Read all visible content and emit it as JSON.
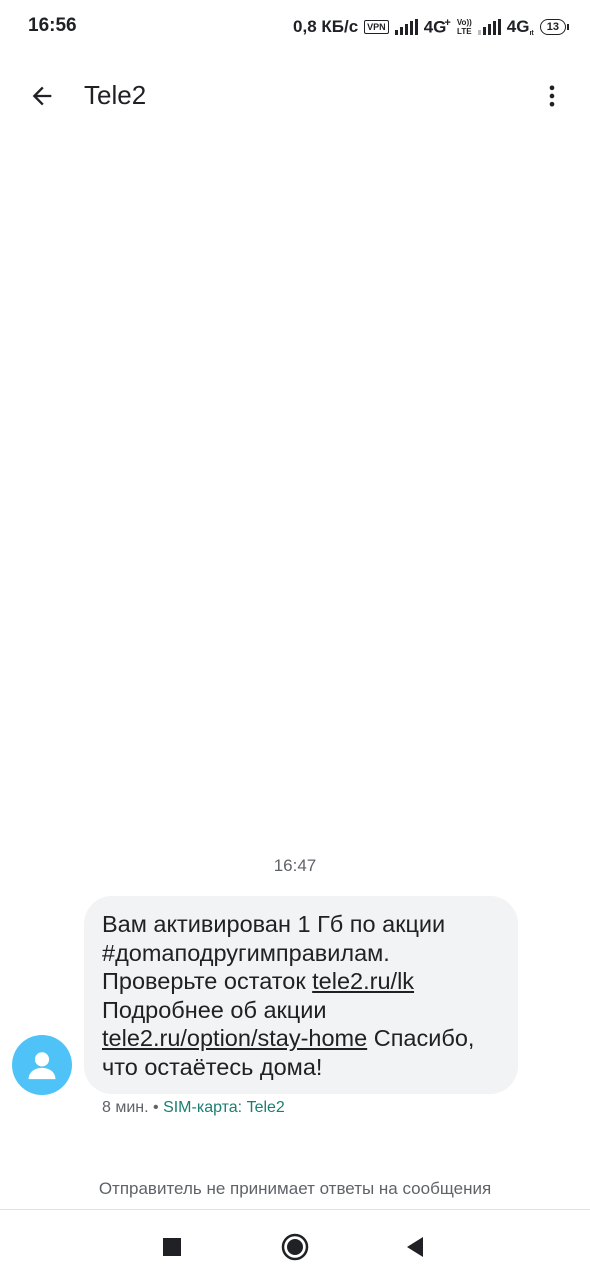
{
  "status_bar": {
    "time": "16:56",
    "speed": "0,8 КБ/с",
    "vpn": "VPN",
    "net1": "4G",
    "net1_plus": "+",
    "volte_top": "Vo))",
    "volte_bottom": "LTE",
    "net2": "4G",
    "net2_small": "ıt",
    "battery": "13"
  },
  "app_bar": {
    "title": "Tele2"
  },
  "conversation": {
    "time_header": "16:47",
    "message": {
      "part1": "Вам активирован 1 Гб по акции #доmaподругимправилам. Проверьте остаток ",
      "link1": "tele2.ru/lk",
      "part2": " Подробнее об акции ",
      "link2": "tele2.ru/option/stay-home",
      "part3": " Спасибо, что остаётесь дома!"
    },
    "meta_age": "8 мин.",
    "meta_sep": " • ",
    "meta_sim": "SIM-карта: Tele2"
  },
  "footer_note": "Отправитель не принимает ответы на сообщения",
  "colors": {
    "avatar": "#4fc3f7",
    "bubble": "#f1f3f4",
    "sim_label": "#1a7f73"
  }
}
